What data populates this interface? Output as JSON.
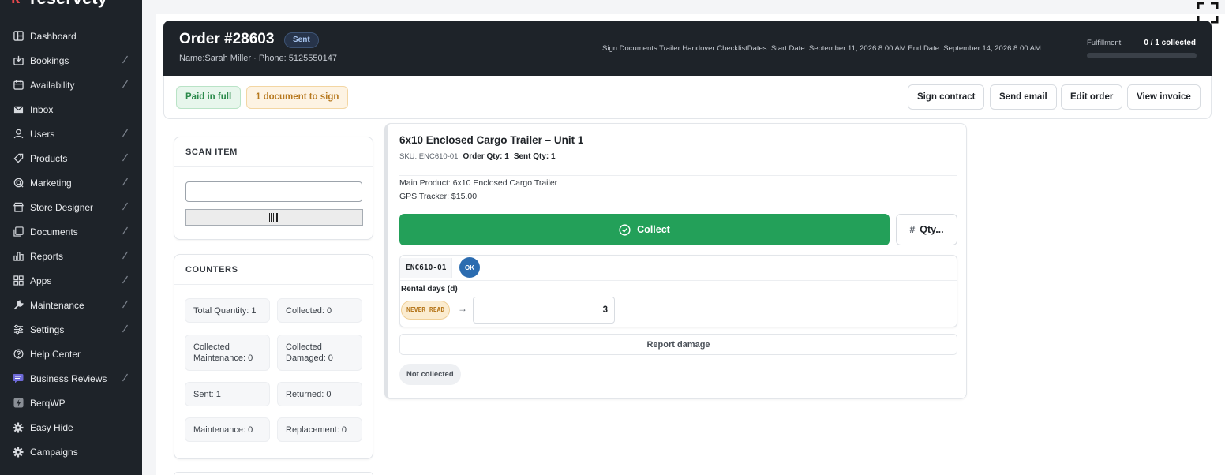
{
  "brand": {
    "name": "reservety"
  },
  "sidebar": {
    "items": [
      {
        "label": "Dashboard",
        "icon": "dashboard-icon",
        "has_submenu": false
      },
      {
        "label": "Bookings",
        "icon": "bookings-icon",
        "has_submenu": true
      },
      {
        "label": "Availability",
        "icon": "calendar-icon",
        "has_submenu": true
      },
      {
        "label": "Inbox",
        "icon": "mail-icon",
        "has_submenu": false
      },
      {
        "label": "Users",
        "icon": "user-icon",
        "has_submenu": true
      },
      {
        "label": "Products",
        "icon": "tag-icon",
        "has_submenu": true
      },
      {
        "label": "Marketing",
        "icon": "marketing-icon",
        "has_submenu": true
      },
      {
        "label": "Store Designer",
        "icon": "store-icon",
        "has_submenu": true
      },
      {
        "label": "Documents",
        "icon": "documents-icon",
        "has_submenu": true
      },
      {
        "label": "Reports",
        "icon": "reports-icon",
        "has_submenu": true
      },
      {
        "label": "Apps",
        "icon": "apps-icon",
        "has_submenu": true
      },
      {
        "label": "Maintenance",
        "icon": "wrench-icon",
        "has_submenu": true
      },
      {
        "label": "Settings",
        "icon": "sliders-icon",
        "has_submenu": true
      },
      {
        "label": "Help Center",
        "icon": "help-icon",
        "has_submenu": false
      },
      {
        "label": "Business Reviews",
        "icon": "reviews-icon",
        "has_submenu": true
      },
      {
        "label": "BerqWP",
        "icon": "bolt-icon",
        "has_submenu": false
      },
      {
        "label": "Easy Hide",
        "icon": "gear-icon",
        "has_submenu": false
      },
      {
        "label": "Campaigns",
        "icon": "gear-icon",
        "has_submenu": false
      }
    ]
  },
  "order": {
    "title": "Order #28603",
    "status": "Sent",
    "customer": "Name:Sarah Miller · Phone: 5125550147",
    "dates": "Sign Documents Trailer Handover ChecklistDates:  Start Date: September 11, 2026 8:00 AM  End Date: September 14, 2026 8:00 AM",
    "fulfillment_label": "Fulfillment",
    "fulfillment_value": "0 / 1 collected",
    "fulfillment_progress": 0
  },
  "actions": {
    "paid_badge": "Paid in full",
    "doc_badge": "1 document to sign",
    "buttons": [
      "Sign contract",
      "Send email",
      "Edit order",
      "View invoice"
    ]
  },
  "scan": {
    "title": "SCAN ITEM",
    "input_value": "",
    "barcode_glyph": "||||||"
  },
  "counters": {
    "title": "COUNTERS",
    "items": [
      "Total Quantity: 1",
      "Collected: 0",
      "Collected Maintenance: 0",
      "Collected Damaged: 0",
      "Sent: 1",
      "Returned: 0",
      "Maintenance: 0",
      "Replacement: 0"
    ]
  },
  "item": {
    "title": "6x10 Enclosed Cargo Trailer – Unit 1",
    "sku": "SKU: ENC610-01",
    "order_qty": "Order Qty: 1",
    "sent_qty": "Sent Qty: 1",
    "main_product": "Main Product: 6x10 Enclosed Cargo Trailer",
    "gps_tracker": "GPS Tracker: $15.00",
    "collect_label": "Collect",
    "qty_label": "Qty...",
    "unit_code": "ENC610-01",
    "unit_status": "OK",
    "rental_label": "Rental days (d)",
    "never_read": "NEVER READ",
    "arrow": "→",
    "rental_value": "3",
    "report_damage": "Report damage",
    "collection_status": "Not collected"
  },
  "colors": {
    "sidebar_bg": "#1e2329",
    "collect_green": "#23a059",
    "ok_blue": "#2b6cb0",
    "brand_red": "#e5484d"
  }
}
